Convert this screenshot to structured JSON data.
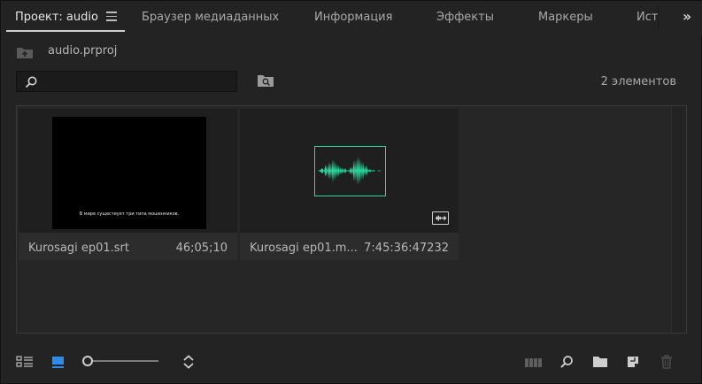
{
  "tabs": [
    {
      "label": "Проект: audio",
      "active": true
    },
    {
      "label": "Браузер медиаданных",
      "active": false
    },
    {
      "label": "Информация",
      "active": false
    },
    {
      "label": "Эффекты",
      "active": false
    },
    {
      "label": "Маркеры",
      "active": false
    },
    {
      "label": "Ист",
      "active": false
    }
  ],
  "tab_overflow_icon": "double-chevron-right",
  "project": {
    "file_name": "audio.prproj",
    "icon": "bin-up-icon"
  },
  "search": {
    "value": "",
    "placeholder": ""
  },
  "item_count": "2 элементов",
  "items": [
    {
      "name": "Kurosagi ep01.srt",
      "duration": "46;05;10",
      "type": "captions",
      "thumbnail_text": "В мире существует три типа мошенников."
    },
    {
      "name": "Kurosagi ep01.m...",
      "duration": "7:45:36:47232",
      "type": "audio",
      "badge_icon": "audio-clip-icon"
    }
  ],
  "toolbar": {
    "icons": [
      "list-view-icon",
      "icon-view-icon",
      "zoom-slider",
      "sort-icon",
      "automate-to-sequence-icon",
      "find-icon",
      "new-bin-icon",
      "new-item-icon",
      "clear-icon"
    ],
    "active_view": "icon-view"
  },
  "colors": {
    "accent_blue": "#2d8ceb",
    "waveform_green": "#2fd39c",
    "panel_bg": "#232323"
  }
}
